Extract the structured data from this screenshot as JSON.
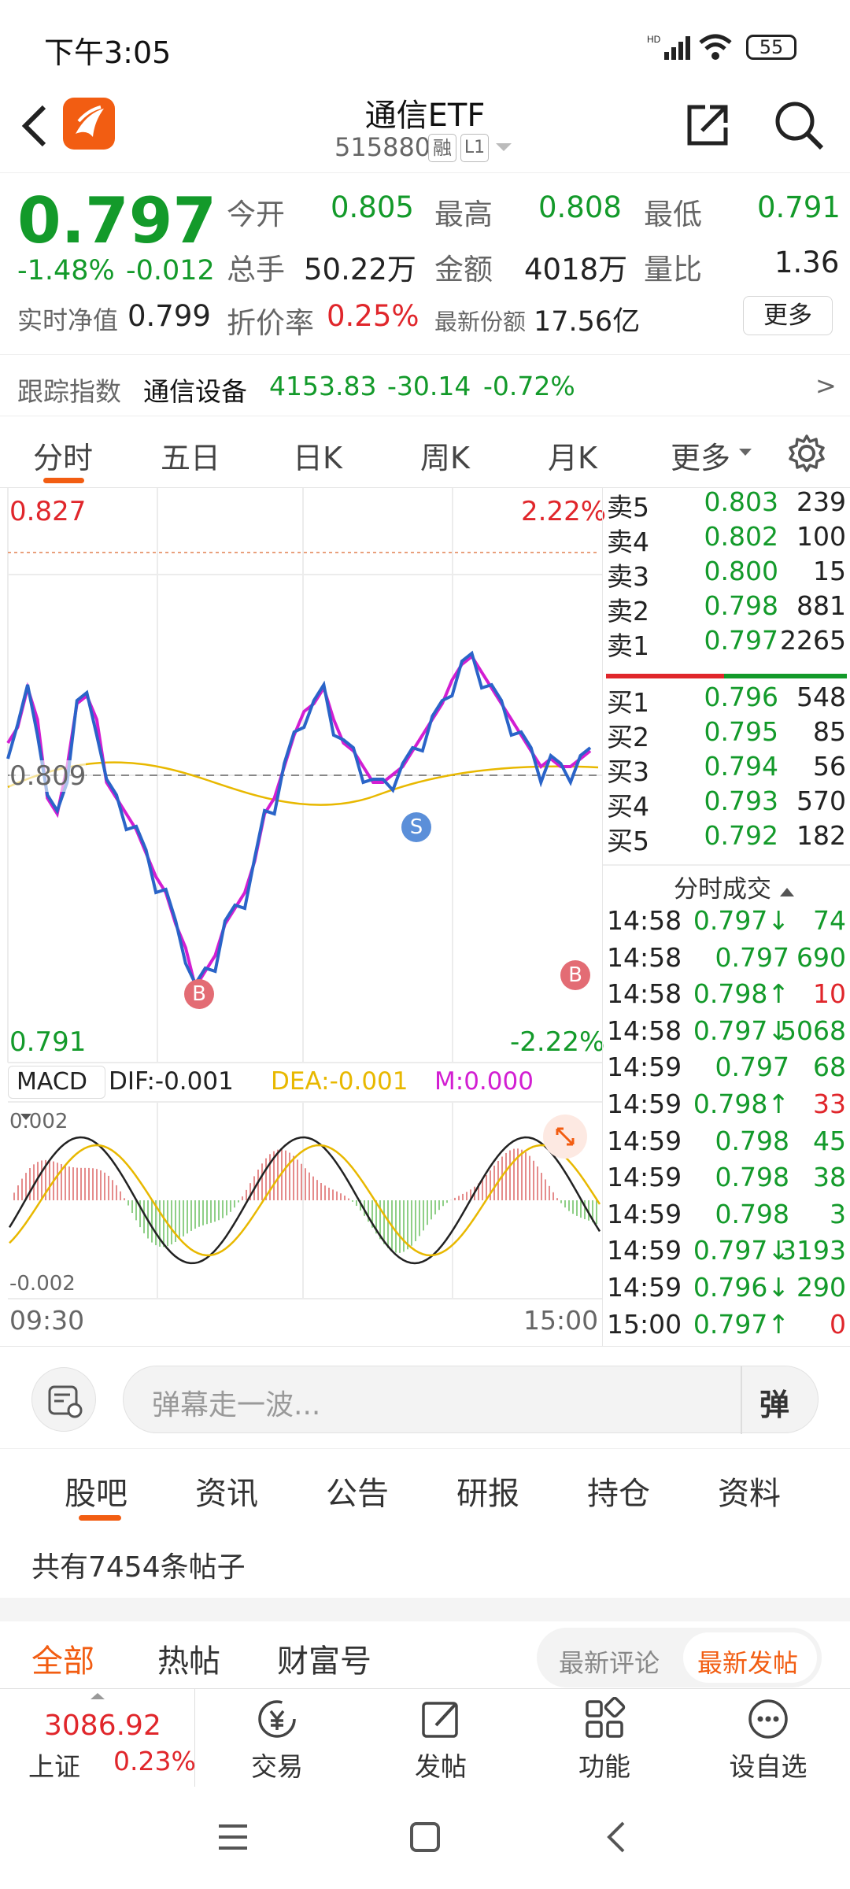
{
  "status": {
    "time": "下午3:05",
    "battery": "55"
  },
  "header": {
    "title": "通信ETF",
    "code": "515880",
    "badge_margin": "融",
    "badge_level": "L1"
  },
  "quote": {
    "price": "0.797",
    "change_pct": "-1.48%",
    "change": "-0.012",
    "open_label": "今开",
    "open": "0.805",
    "high_label": "最高",
    "high": "0.808",
    "low_label": "最低",
    "low": "0.791",
    "volume_label": "总手",
    "volume": "50.22万",
    "amount_label": "金额",
    "amount": "4018万",
    "ratio_label": "量比",
    "ratio": "1.36",
    "nav_label": "实时净值",
    "nav": "0.799",
    "discount_label": "折价率",
    "discount": "0.25%",
    "shares_label": "最新份额",
    "shares": "17.56亿",
    "more": "更多"
  },
  "tracking": {
    "label": "跟踪指数",
    "name": "通信设备",
    "value": "4153.83",
    "change": "-30.14",
    "pct": "-0.72%",
    "arrow": ">"
  },
  "tabs": [
    "分时",
    "五日",
    "日K",
    "周K",
    "月K",
    "更多"
  ],
  "chart": {
    "top_price": "0.827",
    "top_pct": "2.22%",
    "mid_price": "0.809",
    "bottom_price": "0.791",
    "bottom_pct": "-2.22%",
    "macd_label": "MACD",
    "dif": "DIF:-0.001",
    "dea": "DEA:-0.001",
    "m": "M:0.000",
    "macd_top": "0.002",
    "macd_bottom": "-0.002",
    "time_start": "09:30",
    "time_end": "15:00",
    "sell_marker": "S",
    "buy_marker": "B"
  },
  "chart_data": {
    "type": "line",
    "x_range": [
      "09:30",
      "15:00"
    ],
    "ylim": [
      0.791,
      0.827
    ],
    "prev_close_ref": 0.809,
    "series": [],
    "markers": [
      {
        "label": "S",
        "time": "13:30"
      },
      {
        "label": "B",
        "time": "10:45"
      },
      {
        "label": "B",
        "time": "14:50"
      }
    ],
    "macd": {
      "dif": -0.001,
      "dea": -0.001,
      "m": 0.0,
      "ylim": [
        -0.002,
        0.002
      ]
    }
  },
  "orderbook": {
    "asks": [
      {
        "label": "卖5",
        "price": "0.803",
        "vol": "239"
      },
      {
        "label": "卖4",
        "price": "0.802",
        "vol": "100"
      },
      {
        "label": "卖3",
        "price": "0.800",
        "vol": "15"
      },
      {
        "label": "卖2",
        "price": "0.798",
        "vol": "881"
      },
      {
        "label": "卖1",
        "price": "0.797",
        "vol": "2265"
      }
    ],
    "bids": [
      {
        "label": "买1",
        "price": "0.796",
        "vol": "548"
      },
      {
        "label": "买2",
        "price": "0.795",
        "vol": "85"
      },
      {
        "label": "买3",
        "price": "0.794",
        "vol": "56"
      },
      {
        "label": "买4",
        "price": "0.793",
        "vol": "570"
      },
      {
        "label": "买5",
        "price": "0.792",
        "vol": "182"
      }
    ],
    "ticks_title": "分时成交",
    "ticks": [
      {
        "time": "14:58",
        "price": "0.797↓",
        "vol": "74",
        "dir": "down"
      },
      {
        "time": "14:58",
        "price": "0.797",
        "vol": "690",
        "dir": "flat"
      },
      {
        "time": "14:58",
        "price": "0.798↑",
        "vol": "10",
        "dir": "up"
      },
      {
        "time": "14:58",
        "price": "0.797↓",
        "vol": "5068",
        "dir": "down"
      },
      {
        "time": "14:59",
        "price": "0.797",
        "vol": "68",
        "dir": "flat"
      },
      {
        "time": "14:59",
        "price": "0.798↑",
        "vol": "33",
        "dir": "up"
      },
      {
        "time": "14:59",
        "price": "0.798",
        "vol": "45",
        "dir": "flat"
      },
      {
        "time": "14:59",
        "price": "0.798",
        "vol": "38",
        "dir": "flat"
      },
      {
        "time": "14:59",
        "price": "0.798",
        "vol": "3",
        "dir": "flat"
      },
      {
        "time": "14:59",
        "price": "0.797↓",
        "vol": "3193",
        "dir": "down"
      },
      {
        "time": "14:59",
        "price": "0.796↓",
        "vol": "290",
        "dir": "down"
      },
      {
        "time": "15:00",
        "price": "0.797↑",
        "vol": "0",
        "dir": "up"
      }
    ]
  },
  "danmu": {
    "placeholder": "弹幕走一波...",
    "btn": "弹"
  },
  "guba_tabs": [
    "股吧",
    "资讯",
    "公告",
    "研报",
    "持仓",
    "资料"
  ],
  "post_count": "共有7454条帖子",
  "sub_tabs": {
    "all": "全部",
    "hot": "热帖",
    "wealth": "财富号",
    "latest_comment": "最新评论",
    "latest_post": "最新发帖"
  },
  "dock": {
    "index_value": "3086.92",
    "index_name": "上证",
    "index_pct": "0.23%",
    "trade": "交易",
    "post": "发帖",
    "func": "功能",
    "watch": "设自选"
  },
  "colors": {
    "up": "#e0262b",
    "down": "#139a2a",
    "accent": "#f25d12",
    "price_line": "#2a64c8",
    "alt_line": "#d21ed2",
    "avg_line": "#e8b800"
  }
}
